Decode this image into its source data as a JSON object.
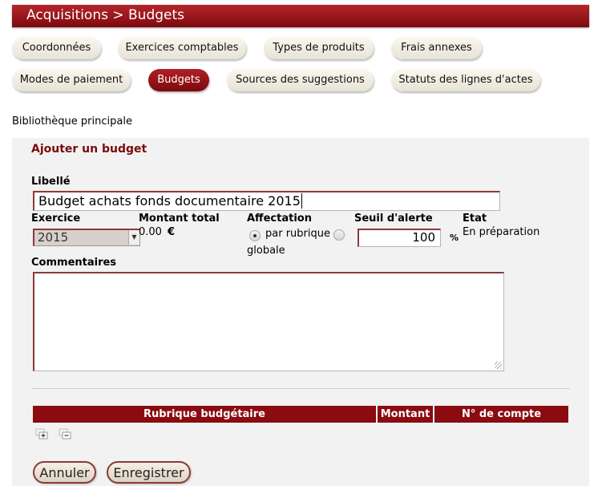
{
  "header": {
    "title": "Acquisitions > Budgets"
  },
  "nav": {
    "tabs": [
      {
        "label": "Coordonnées"
      },
      {
        "label": "Exercices comptables"
      },
      {
        "label": "Types de produits"
      },
      {
        "label": "Frais annexes"
      },
      {
        "label": "Modes de paiement"
      },
      {
        "label": "Budgets",
        "active": true
      },
      {
        "label": "Sources des suggestions"
      },
      {
        "label": "Statuts des lignes d'actes"
      }
    ]
  },
  "library": "Bibliothèque principale",
  "form": {
    "title": "Ajouter un budget",
    "libelle_label": "Libellé",
    "libelle_value": "Budget achats fonds documentaire 2015",
    "exercice_label": "Exercice",
    "exercice_value": "2015",
    "montant_label": "Montant total",
    "montant_value": "0.00",
    "currency": "€",
    "affectation_label": "Affectation",
    "affectation_option1": "par rubrique",
    "affectation_option2": "globale",
    "affectation_selected": "par rubrique",
    "seuil_label": "Seuil d'alerte",
    "seuil_value": "100",
    "seuil_unit": "%",
    "etat_label": "Etat",
    "etat_value": "En préparation",
    "commentaires_label": "Commentaires",
    "commentaires_value": ""
  },
  "table": {
    "headers": [
      "Rubrique budgétaire",
      "Montant",
      "N° de compte"
    ]
  },
  "buttons": {
    "cancel": "Annuler",
    "save": "Enregistrer"
  },
  "colors": {
    "accent": "#8a0b10",
    "panel": "#f2f2f2"
  },
  "icons": [
    "add-row-icon",
    "remove-row-icon",
    "dropdown-arrow-icon",
    "resize-handle-icon"
  ]
}
